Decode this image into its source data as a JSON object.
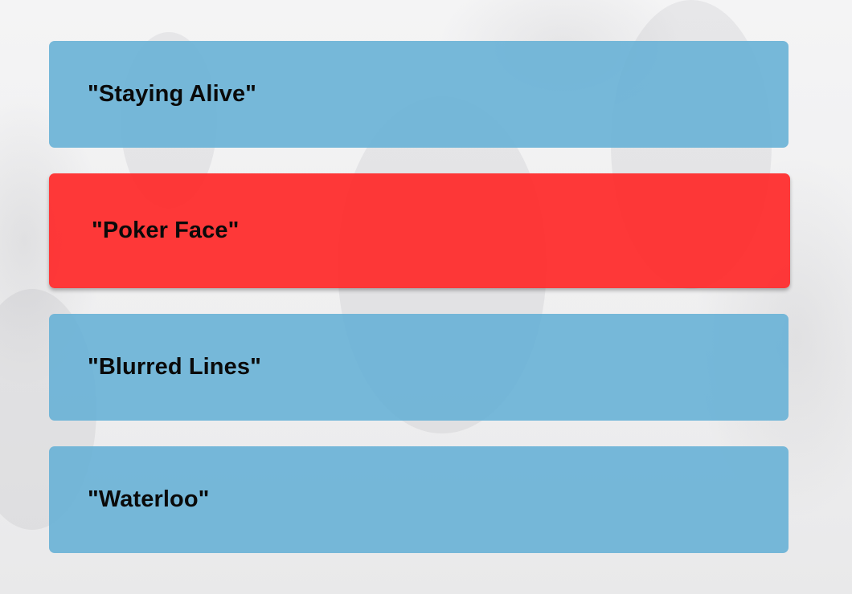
{
  "quiz": {
    "answers": [
      {
        "label": "\"Staying Alive\"",
        "selected": false
      },
      {
        "label": "\"Poker Face\"",
        "selected": true
      },
      {
        "label": "\"Blurred Lines\"",
        "selected": false
      },
      {
        "label": "\"Waterloo\"",
        "selected": false
      }
    ]
  },
  "colors": {
    "answer_default": "#68b1d6",
    "answer_selected": "#ff2828",
    "text": "#0a0a0a",
    "background": "#f3f3f4"
  }
}
